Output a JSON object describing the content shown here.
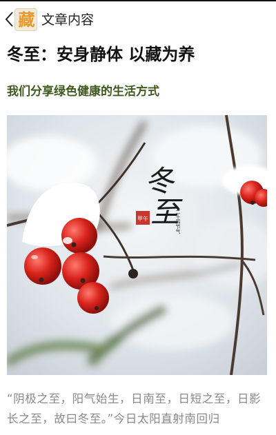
{
  "header": {
    "back_icon": "chevron-left-icon",
    "logo_char": "藏",
    "logo_color": "#e79a2b",
    "title": "文章内容"
  },
  "article": {
    "title": "冬至：安身静体 以藏为养",
    "subtitle": "我们分享绿色健康的生活方式",
    "subtitle_color": "#3f5a1e",
    "image": {
      "calligraphy_main": "冬至",
      "seal_text": "甲午",
      "side_text": "二十四节气"
    },
    "body": "“阴极之至，阳气始生，日南至，日短之至，日影长之至，故曰冬至。”今日太阳直射南回归"
  }
}
